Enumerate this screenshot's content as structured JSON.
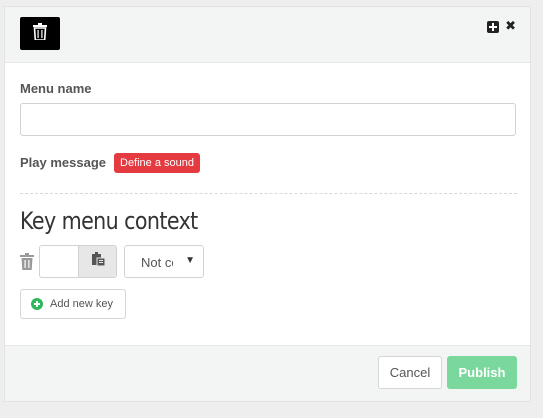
{
  "header": {
    "delete_icon": "trash-icon",
    "expand_icon": "plus-square-icon",
    "close_icon": "close-icon",
    "close_glyph": "✖"
  },
  "form": {
    "menu_name_label": "Menu name",
    "menu_name_value": "",
    "play_message_label": "Play message",
    "define_sound_label": "Define a sound"
  },
  "key_menu": {
    "title": "Key menu context",
    "rows": [
      {
        "key_value": "",
        "action_value": "Not co"
      }
    ],
    "add_key_label": "Add new key"
  },
  "footer": {
    "cancel_label": "Cancel",
    "publish_label": "Publish"
  },
  "colors": {
    "danger": "#e53a40",
    "success": "#2eb85c",
    "publish": "#7bd89c"
  }
}
